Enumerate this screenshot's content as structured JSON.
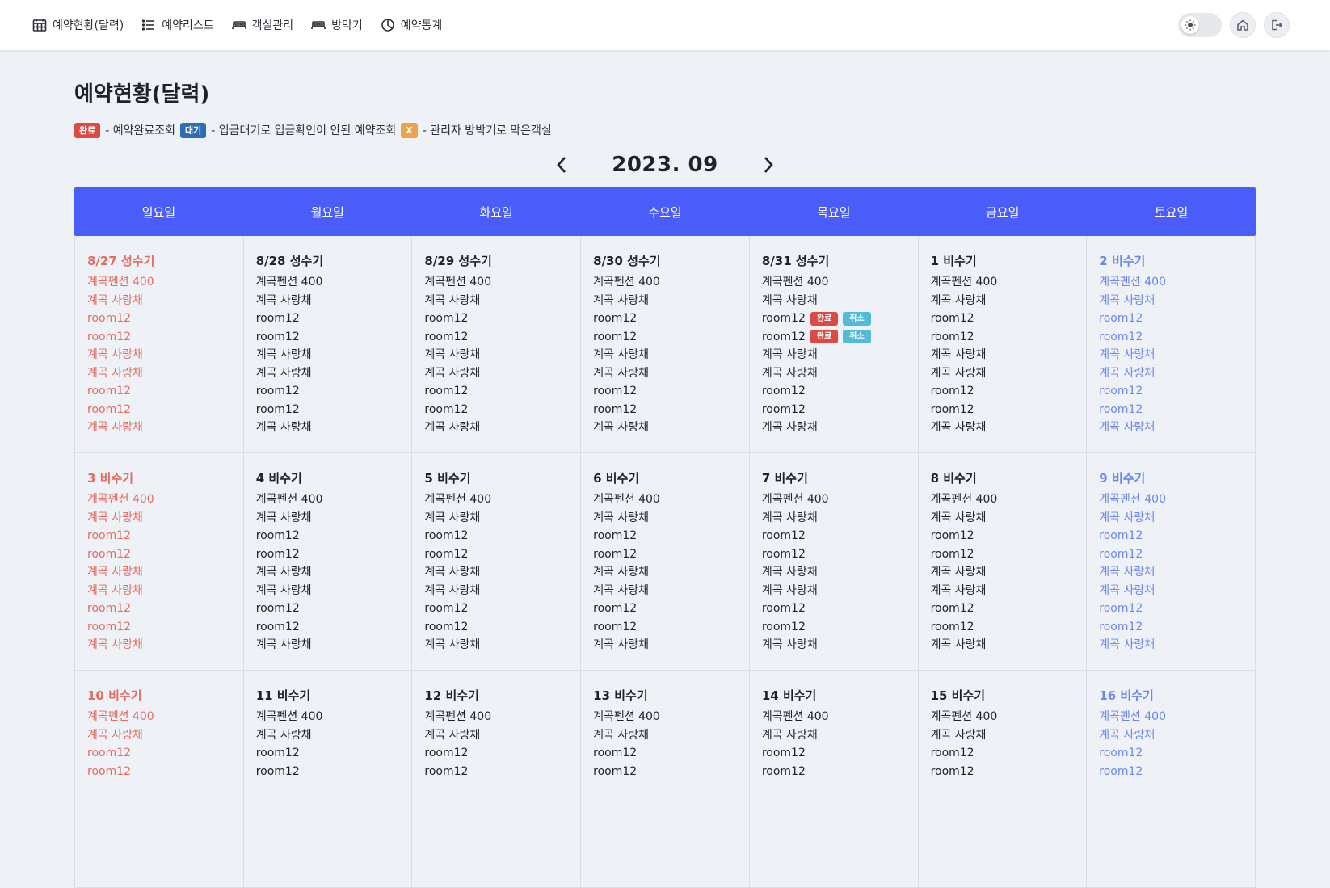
{
  "nav": {
    "items": [
      {
        "label": "예약현황(달력)",
        "icon": "calendar-icon"
      },
      {
        "label": "예약리스트",
        "icon": "list-icon"
      },
      {
        "label": "객실관리",
        "icon": "bed-icon"
      },
      {
        "label": "방막기",
        "icon": "bed-icon"
      },
      {
        "label": "예약통계",
        "icon": "pie-chart-icon"
      }
    ]
  },
  "page": {
    "title": "예약현황(달력)",
    "month": "2023. 09"
  },
  "legend": {
    "done_badge": "완료",
    "done_text": "- 예약완료조회",
    "wait_badge": "대기",
    "wait_text": "- 입금대기로 입금확인이 안된 예약조회",
    "block_badge": "X",
    "block_text": "- 관리자 방박기로 막은객실"
  },
  "colors": {
    "header_bg": "#4a5df9",
    "sunday": "#e46b62",
    "saturday": "#6a86f0",
    "done": "#dc4a45",
    "wait": "#2f6db5",
    "block": "#f0a24a",
    "cancel": "#52bcd7"
  },
  "weekdays": [
    "일요일",
    "월요일",
    "화요일",
    "수요일",
    "목요일",
    "금요일",
    "토요일"
  ],
  "weeks": [
    [
      {
        "date": "8/27 성수기",
        "lines": [
          "계곡펜션 400",
          "계곡 사랑채",
          "room12",
          "room12",
          "계곡 사랑채",
          "계곡 사랑채",
          "room12",
          "room12",
          "계곡 사랑채"
        ]
      },
      {
        "date": "8/28 성수기",
        "lines": [
          "계곡펜션 400",
          "계곡 사랑채",
          "room12",
          "room12",
          "계곡 사랑채",
          "계곡 사랑채",
          "room12",
          "room12",
          "계곡 사랑채"
        ]
      },
      {
        "date": "8/29 성수기",
        "lines": [
          "계곡펜션 400",
          "계곡 사랑채",
          "room12",
          "room12",
          "계곡 사랑채",
          "계곡 사랑채",
          "room12",
          "room12",
          "계곡 사랑채"
        ]
      },
      {
        "date": "8/30 성수기",
        "lines": [
          "계곡펜션 400",
          "계곡 사랑채",
          "room12",
          "room12",
          "계곡 사랑채",
          "계곡 사랑채",
          "room12",
          "room12",
          "계곡 사랑채"
        ]
      },
      {
        "date": "8/31 성수기",
        "lines": [
          "계곡펜션 400",
          "계곡 사랑채",
          "room12",
          "room12",
          "계곡 사랑채",
          "계곡 사랑채",
          "room12",
          "room12",
          "계곡 사랑채"
        ],
        "badges": {
          "2": [
            "완료",
            "취소"
          ],
          "3": [
            "완료",
            "취소"
          ]
        }
      },
      {
        "date": "1 비수기",
        "lines": [
          "계곡펜션 400",
          "계곡 사랑채",
          "room12",
          "room12",
          "계곡 사랑채",
          "계곡 사랑채",
          "room12",
          "room12",
          "계곡 사랑채"
        ]
      },
      {
        "date": "2 비수기",
        "lines": [
          "계곡펜션 400",
          "계곡 사랑채",
          "room12",
          "room12",
          "계곡 사랑채",
          "계곡 사랑채",
          "room12",
          "room12",
          "계곡 사랑채"
        ]
      }
    ],
    [
      {
        "date": "3 비수기",
        "lines": [
          "계곡펜션 400",
          "계곡 사랑채",
          "room12",
          "room12",
          "계곡 사랑채",
          "계곡 사랑채",
          "room12",
          "room12",
          "계곡 사랑채"
        ]
      },
      {
        "date": "4 비수기",
        "lines": [
          "계곡펜션 400",
          "계곡 사랑채",
          "room12",
          "room12",
          "계곡 사랑채",
          "계곡 사랑채",
          "room12",
          "room12",
          "계곡 사랑채"
        ]
      },
      {
        "date": "5 비수기",
        "lines": [
          "계곡펜션 400",
          "계곡 사랑채",
          "room12",
          "room12",
          "계곡 사랑채",
          "계곡 사랑채",
          "room12",
          "room12",
          "계곡 사랑채"
        ]
      },
      {
        "date": "6 비수기",
        "lines": [
          "계곡펜션 400",
          "계곡 사랑채",
          "room12",
          "room12",
          "계곡 사랑채",
          "계곡 사랑채",
          "room12",
          "room12",
          "계곡 사랑채"
        ]
      },
      {
        "date": "7 비수기",
        "lines": [
          "계곡펜션 400",
          "계곡 사랑채",
          "room12",
          "room12",
          "계곡 사랑채",
          "계곡 사랑채",
          "room12",
          "room12",
          "계곡 사랑채"
        ]
      },
      {
        "date": "8 비수기",
        "lines": [
          "계곡펜션 400",
          "계곡 사랑채",
          "room12",
          "room12",
          "계곡 사랑채",
          "계곡 사랑채",
          "room12",
          "room12",
          "계곡 사랑채"
        ]
      },
      {
        "date": "9 비수기",
        "lines": [
          "계곡펜션 400",
          "계곡 사랑채",
          "room12",
          "room12",
          "계곡 사랑채",
          "계곡 사랑채",
          "room12",
          "room12",
          "계곡 사랑채"
        ]
      }
    ],
    [
      {
        "date": "10 비수기",
        "lines": [
          "계곡펜션 400",
          "계곡 사랑채",
          "room12",
          "room12"
        ]
      },
      {
        "date": "11 비수기",
        "lines": [
          "계곡펜션 400",
          "계곡 사랑채",
          "room12",
          "room12"
        ]
      },
      {
        "date": "12 비수기",
        "lines": [
          "계곡펜션 400",
          "계곡 사랑채",
          "room12",
          "room12"
        ]
      },
      {
        "date": "13 비수기",
        "lines": [
          "계곡펜션 400",
          "계곡 사랑채",
          "room12",
          "room12"
        ]
      },
      {
        "date": "14 비수기",
        "lines": [
          "계곡펜션 400",
          "계곡 사랑채",
          "room12",
          "room12"
        ]
      },
      {
        "date": "15 비수기",
        "lines": [
          "계곡펜션 400",
          "계곡 사랑채",
          "room12",
          "room12"
        ]
      },
      {
        "date": "16 비수기",
        "lines": [
          "계곡펜션 400",
          "계곡 사랑채",
          "room12",
          "room12"
        ]
      }
    ]
  ]
}
